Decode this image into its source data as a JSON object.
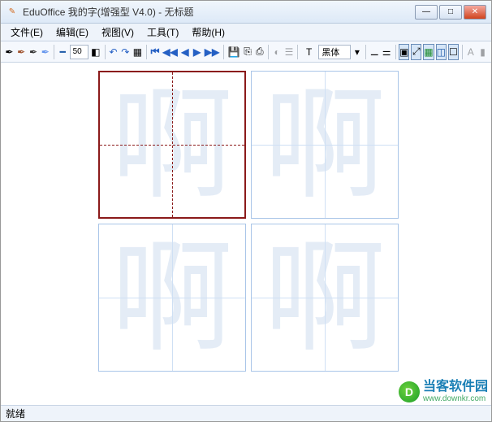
{
  "window": {
    "title": "EduOffice 我的字(增强型 V4.0) - 无标题",
    "minimize": "—",
    "maximize": "□",
    "close": "✕"
  },
  "menu": {
    "file": "文件(E)",
    "edit": "编辑(E)",
    "view": "视图(V)",
    "tools": "工具(T)",
    "help": "帮助(H)"
  },
  "toolbar": {
    "spin_value": "50",
    "font_label": "T",
    "font_value": "黑体"
  },
  "canvas": {
    "character": "啊"
  },
  "status": {
    "text": "就绪"
  },
  "watermark": {
    "brand": "当客软件园",
    "url": "www.downkr.com",
    "logo_letter": "D"
  }
}
